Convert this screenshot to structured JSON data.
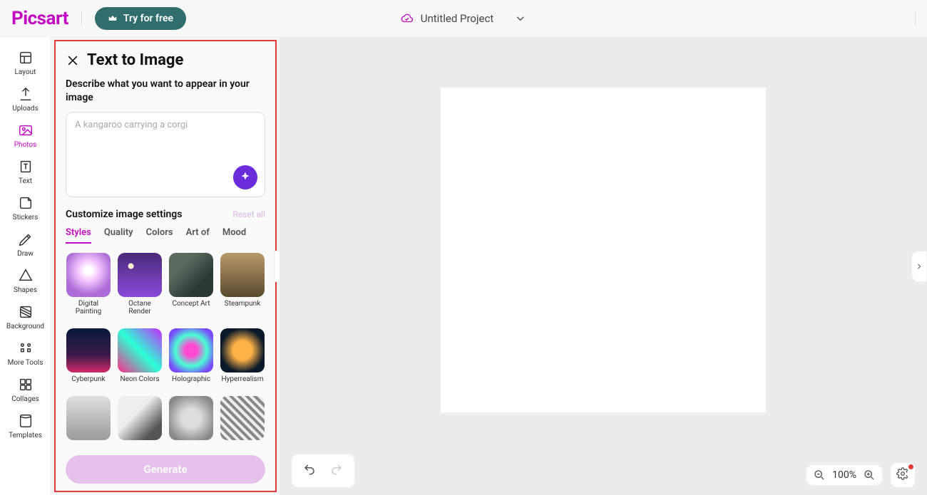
{
  "header": {
    "logo": "Picsart",
    "try_label": "Try for free",
    "project_name": "Untitled Project"
  },
  "rail": {
    "items": [
      {
        "key": "layout",
        "label": "Layout"
      },
      {
        "key": "uploads",
        "label": "Uploads"
      },
      {
        "key": "photos",
        "label": "Photos"
      },
      {
        "key": "text",
        "label": "Text"
      },
      {
        "key": "stickers",
        "label": "Stickers"
      },
      {
        "key": "draw",
        "label": "Draw"
      },
      {
        "key": "shapes",
        "label": "Shapes"
      },
      {
        "key": "background",
        "label": "Background"
      },
      {
        "key": "moretools",
        "label": "More Tools"
      },
      {
        "key": "collages",
        "label": "Collages"
      },
      {
        "key": "templates",
        "label": "Templates"
      }
    ],
    "active_index": 2
  },
  "panel": {
    "title": "Text to Image",
    "describe_label": "Describe what you want to appear in your image",
    "prompt_placeholder": "A kangaroo carrying a corgi",
    "prompt_value": "",
    "customize_label": "Customize image settings",
    "reset_label": "Reset all",
    "tabs": [
      "Styles",
      "Quality",
      "Colors",
      "Art of",
      "Mood"
    ],
    "active_tab": 0,
    "styles": [
      {
        "name": "Digital Painting",
        "thumb": "t-digital"
      },
      {
        "name": "Octane Render",
        "thumb": "t-octane"
      },
      {
        "name": "Concept Art",
        "thumb": "t-concept"
      },
      {
        "name": "Steampunk",
        "thumb": "t-steam"
      },
      {
        "name": "Cyberpunk",
        "thumb": "t-cyber"
      },
      {
        "name": "Neon Colors",
        "thumb": "t-neon"
      },
      {
        "name": "Holographic",
        "thumb": "t-holo"
      },
      {
        "name": "Hyperrealism",
        "thumb": "t-hyper"
      },
      {
        "name": "",
        "thumb": "t-grey1"
      },
      {
        "name": "",
        "thumb": "t-grey2"
      },
      {
        "name": "",
        "thumb": "t-grey3"
      },
      {
        "name": "",
        "thumb": "t-grey4"
      }
    ],
    "generate_label": "Generate"
  },
  "zoom": {
    "level": "100%"
  }
}
